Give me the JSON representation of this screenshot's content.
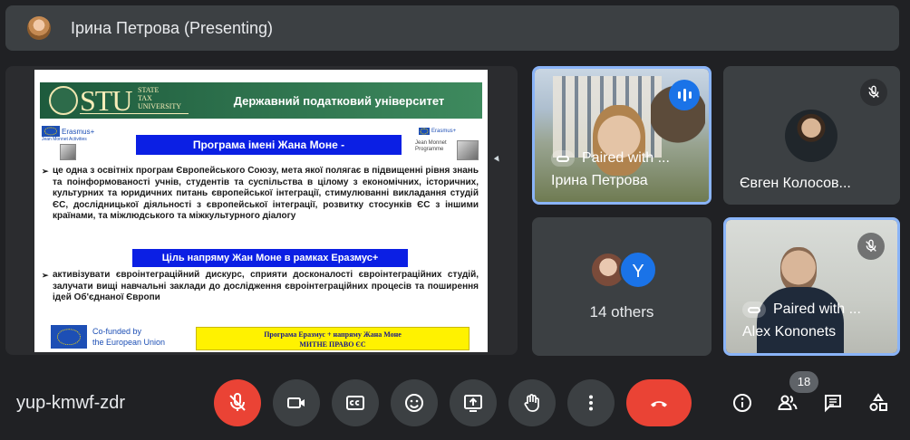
{
  "header": {
    "presenter_title": "Ірина Петрова (Presenting)"
  },
  "slide": {
    "university_abbr": "STU",
    "university_full": "STATE\nTAX\nUNIVERSITY",
    "title": "Державний податковий університет",
    "erasmus_left": "Erasmus+",
    "jean_monnet_left": "Jean Monnet Activities",
    "erasmus_right": "Erasmus+",
    "jean_monnet_right": "Jean Monnet Programme",
    "program_heading": "Програма імені Жана Моне -",
    "paragraph1": "це одна з освітніх програм Європейського Союзу, мета якої полягає в підвищенні рівня знань та поінформованості учнів, студентів та суспільства в цілому з економічних, історичних, культурних та юридичних питань європейської інтеграції, стимулюванні викладання студій ЄС, дослідницької діяльності з європейської інтеграції, розвитку стосунків ЄС з іншими країнами, та міжлюдського та міжкультурного діалогу",
    "goal_heading": "Ціль напряму Жан Моне в рамках Еразмус+",
    "paragraph2": "активізувати євроінтеграційний дискурс, сприяти досконалості євроінтеграційних студій, залучати вищі навчальні заклади до дослідження євроінтеграційних процесів та поширення ідей Об'єднаної Європи",
    "cofunded_line1": "Co-funded by",
    "cofunded_line2": "the European Union",
    "footer_line1": "Програма Еразмус + напряму Жана Моне",
    "footer_line2": "МИТНЕ ПРАВО ЄС"
  },
  "participants": {
    "irina": {
      "paired": "Paired with ...",
      "name": "Ірина Петрова"
    },
    "evgen": {
      "name": "Євген Колосов..."
    },
    "others": {
      "avatar_letter": "Y",
      "label": "14 others"
    },
    "alex": {
      "paired": "Paired with ...",
      "name": "Alex Kononets"
    }
  },
  "bottombar": {
    "meeting_code": "yup-kmwf-zdr",
    "people_count": "18"
  },
  "colors": {
    "background": "#202124",
    "tile": "#3c4043",
    "active_border": "#8ab4f8",
    "red": "#ea4335",
    "accent_blue": "#1a73e8"
  }
}
